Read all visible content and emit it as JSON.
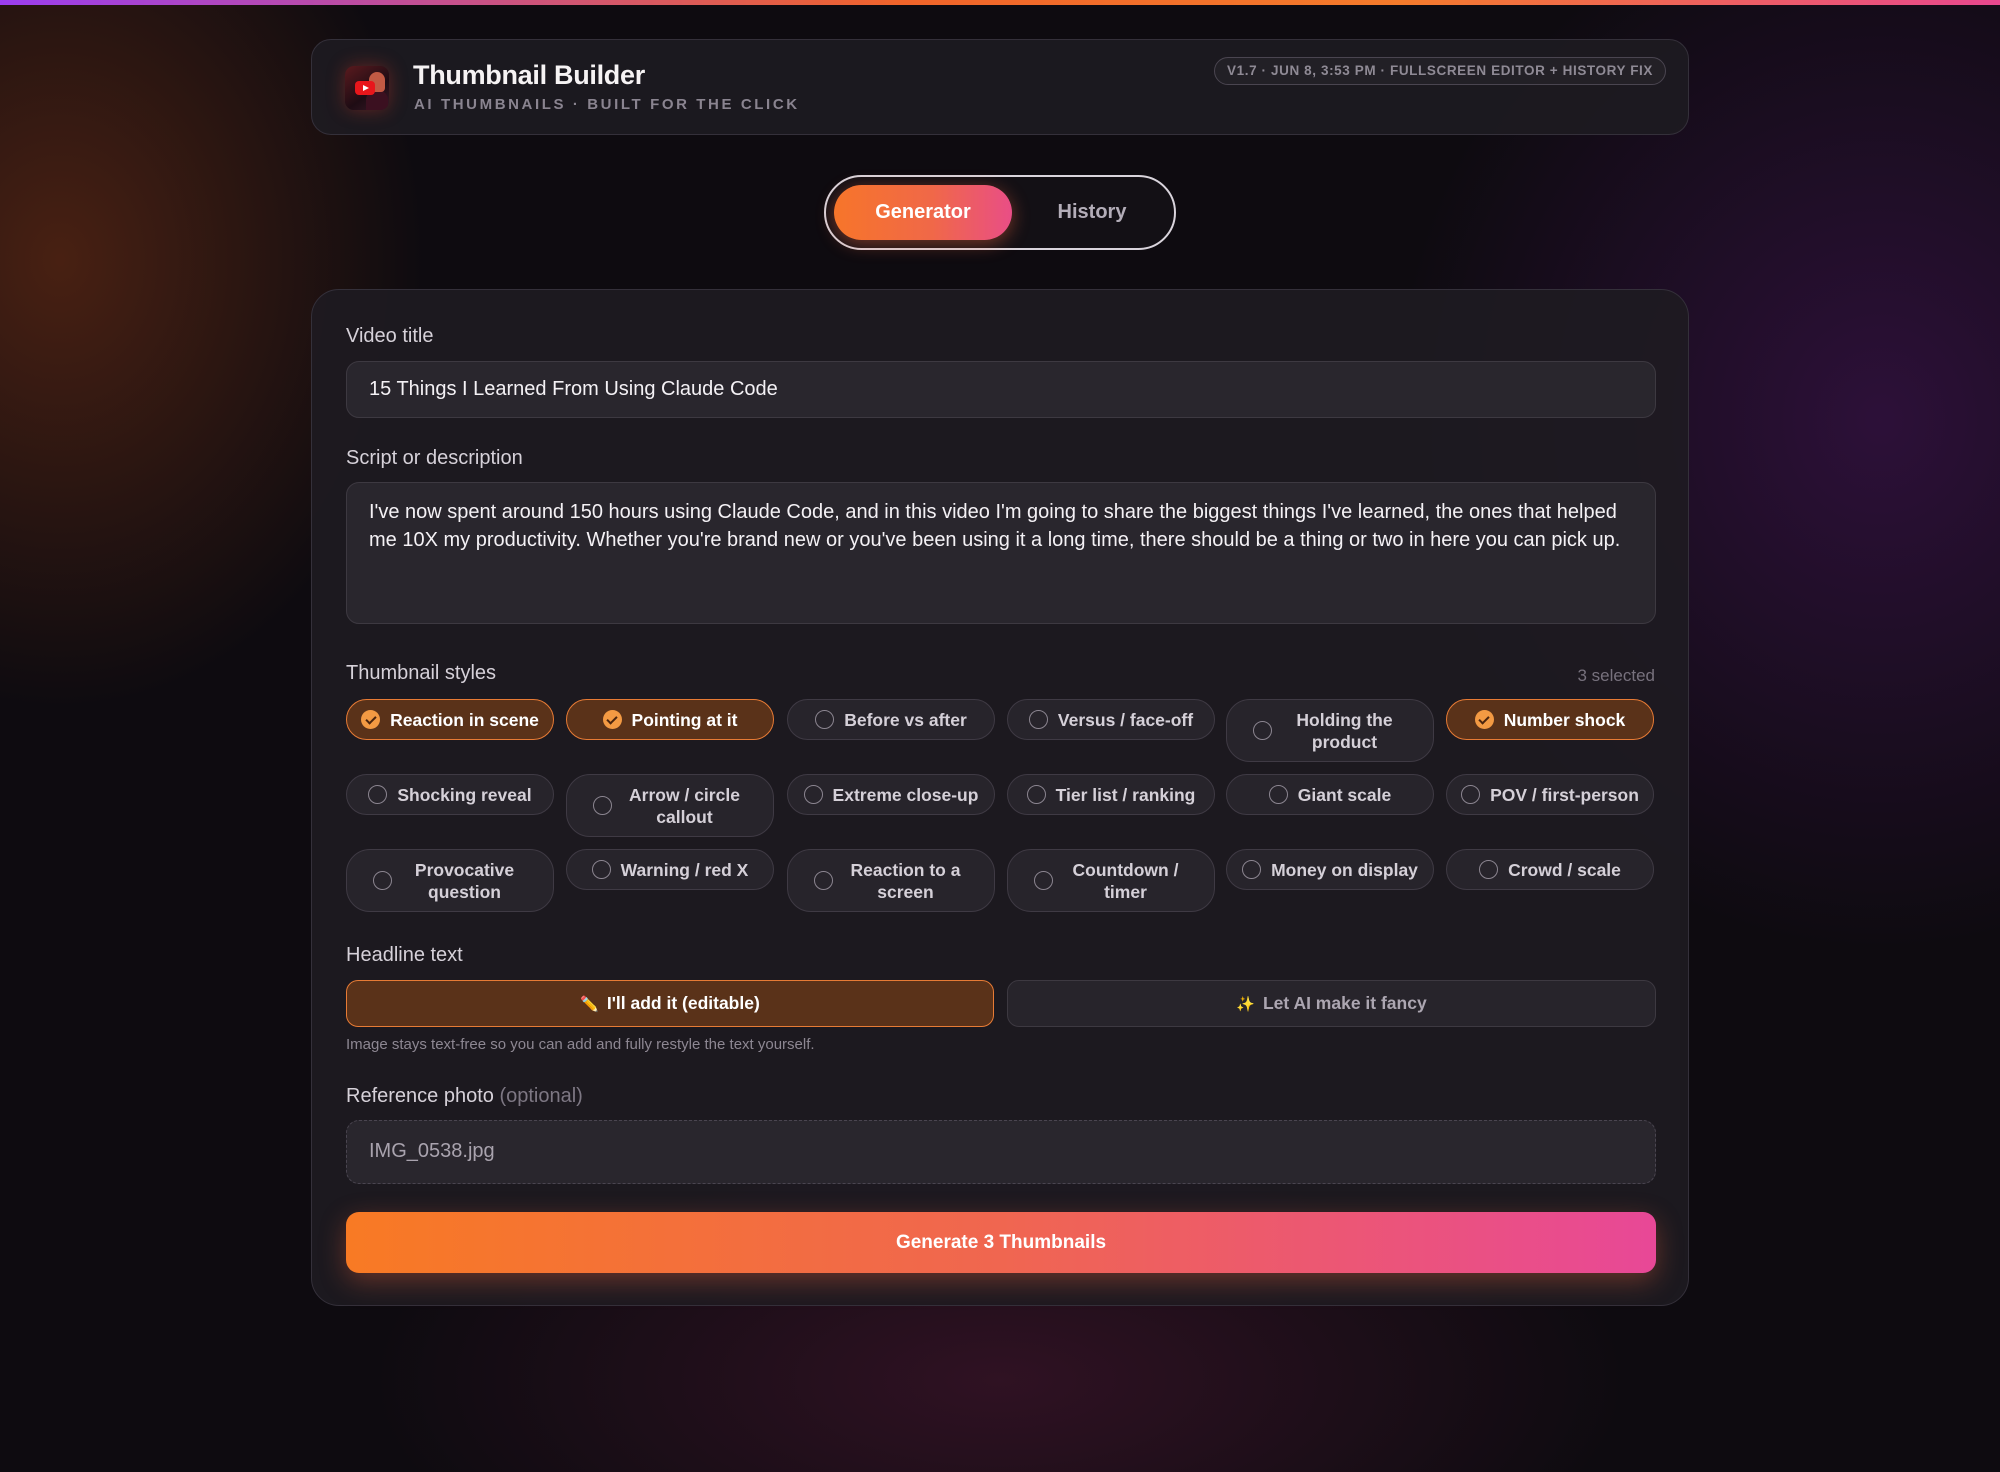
{
  "app": {
    "title": "Thumbnail Builder",
    "subtitle": "AI THUMBNAILS · BUILT FOR THE CLICK",
    "version": "V1.7 · JUN 8, 3:53 PM · FULLSCREEN EDITOR + HISTORY FIX",
    "logo_icon": "youtube-thumbnail-logo"
  },
  "tabs": [
    {
      "label": "Generator",
      "active": true
    },
    {
      "label": "History",
      "active": false
    }
  ],
  "form": {
    "video_title_label": "Video title",
    "video_title_value": "15 Things I Learned From Using Claude Code",
    "script_label": "Script or description",
    "script_value": "I've now spent around 150 hours using Claude Code, and in this video I'm going to share the biggest things I've learned, the ones that helped me 10X my productivity. Whether you're brand new or you've been using it a long time, there should be a thing or two in here you can pick up.",
    "styles_label": "Thumbnail styles",
    "selected_count": "3 selected",
    "styles": [
      {
        "label": "Reaction in scene",
        "selected": true
      },
      {
        "label": "Pointing at it",
        "selected": true
      },
      {
        "label": "Before vs after",
        "selected": false
      },
      {
        "label": "Versus / face-off",
        "selected": false
      },
      {
        "label": "Holding the product",
        "selected": false
      },
      {
        "label": "Number shock",
        "selected": true
      },
      {
        "label": "Shocking reveal",
        "selected": false
      },
      {
        "label": "Arrow / circle callout",
        "selected": false
      },
      {
        "label": "Extreme close-up",
        "selected": false
      },
      {
        "label": "Tier list / ranking",
        "selected": false
      },
      {
        "label": "Giant scale",
        "selected": false
      },
      {
        "label": "POV / first-person",
        "selected": false
      },
      {
        "label": "Provocative question",
        "selected": false
      },
      {
        "label": "Warning / red X",
        "selected": false
      },
      {
        "label": "Reaction to a screen",
        "selected": false
      },
      {
        "label": "Countdown / timer",
        "selected": false
      },
      {
        "label": "Money on display",
        "selected": false
      },
      {
        "label": "Crowd / scale",
        "selected": false
      }
    ],
    "headline_label": "Headline text",
    "headline_options": [
      {
        "icon": "✏️",
        "label": "I'll add it (editable)",
        "selected": true
      },
      {
        "icon": "✨",
        "label": "Let AI make it fancy",
        "selected": false
      }
    ],
    "headline_hint": "Image stays text-free so you can add and fully restyle the text yourself.",
    "reference_label": "Reference photo",
    "reference_optional": "(optional)",
    "reference_value": "IMG_0538.jpg",
    "generate_label": "Generate 3 Thumbnails"
  },
  "colors": {
    "accent_orange": "#f7752a",
    "accent_pink": "#e94e86",
    "selected_bg": "#5a3219",
    "selected_border": "#e77b35"
  }
}
